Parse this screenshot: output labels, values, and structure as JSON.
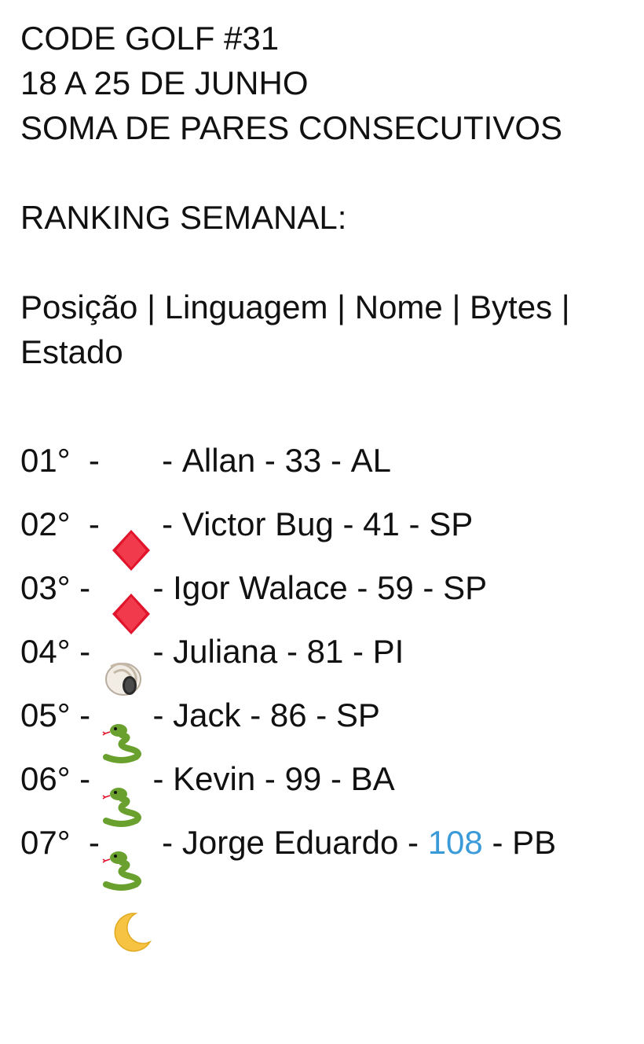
{
  "header": {
    "line1": "CODE GOLF #31",
    "line2": "18 A 25 DE JUNHO",
    "line3": "SOMA DE PARES CONSECUTIVOS"
  },
  "ranking_title": "RANKING SEMANAL:",
  "columns_text": "Posição | Linguagem | Nome | Bytes | Estado",
  "ranking": [
    {
      "position": "01°",
      "lang_icon": "red-diamond-icon",
      "name": "Allan",
      "bytes": "33",
      "state": "AL"
    },
    {
      "position": "02°",
      "lang_icon": "red-diamond-icon",
      "name": "Victor Bug",
      "bytes": "41",
      "state": "SP"
    },
    {
      "position": "03°",
      "lang_icon": "spiral-shell-icon",
      "name": "Igor Walace",
      "bytes": "59",
      "state": "SP"
    },
    {
      "position": "04°",
      "lang_icon": "snake-icon",
      "name": "Juliana",
      "bytes": "81",
      "state": "PI"
    },
    {
      "position": "05°",
      "lang_icon": "snake-icon",
      "name": "Jack",
      "bytes": "86",
      "state": "SP"
    },
    {
      "position": "06°",
      "lang_icon": "snake-icon",
      "name": "Kevin",
      "bytes": "99",
      "state": "BA"
    },
    {
      "position": "07°",
      "lang_icon": "crescent-moon-icon",
      "name": "Jorge Eduardo",
      "bytes": "108",
      "state": "PB"
    }
  ],
  "colors": {
    "text": "#111111",
    "link": "#3a9bd8",
    "diamond": "#e0142b",
    "snake": "#6aa12e",
    "moon": "#f6c343"
  }
}
